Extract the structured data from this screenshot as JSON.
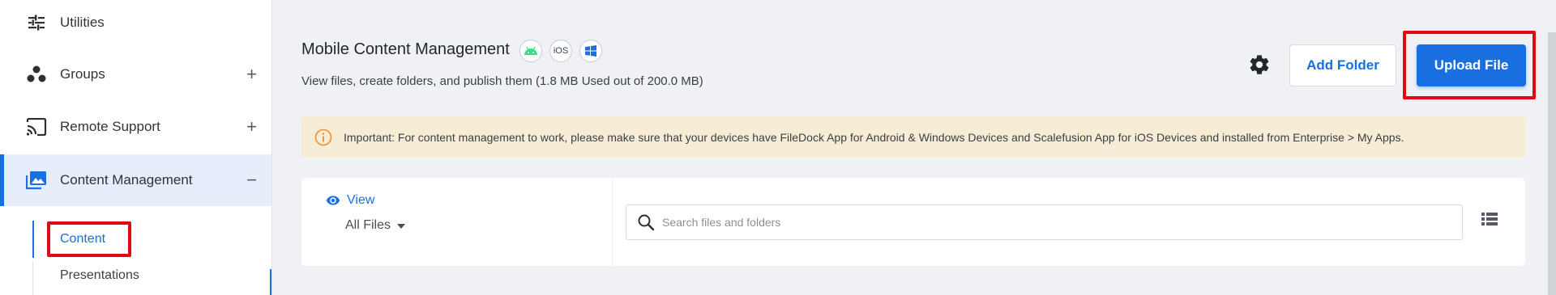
{
  "sidebar": {
    "items": [
      {
        "label": "Utilities",
        "icon": "sliders-icon",
        "toggle": ""
      },
      {
        "label": "Groups",
        "icon": "groups-icon",
        "toggle": "+"
      },
      {
        "label": "Remote Support",
        "icon": "cast-icon",
        "toggle": "+"
      },
      {
        "label": "Content Management",
        "icon": "photo-library-icon",
        "toggle": "−"
      }
    ],
    "sub_items": [
      {
        "label": "Content",
        "active": true
      },
      {
        "label": "Presentations",
        "active": false
      }
    ]
  },
  "header": {
    "title": "Mobile Content Management",
    "subtitle": "View files, create folders, and publish them (1.8 MB Used out of 200.0 MB)",
    "os_badges": [
      "android-icon",
      "iOS",
      "windows-icon"
    ],
    "add_folder_label": "Add Folder",
    "upload_file_label": "Upload File"
  },
  "notice": {
    "text": "Important: For content management to work, please make sure that your devices have FileDock App for Android & Windows Devices and Scalefusion App for iOS Devices and installed from Enterprise > My Apps."
  },
  "files_panel": {
    "view_label": "View",
    "filter_value": "All Files",
    "search_placeholder": "Search files and folders"
  },
  "colors": {
    "accent": "#1a6fe0",
    "highlight": "#e30613",
    "notice_bg": "#f7ecd6",
    "android": "#3ddc84",
    "windows": "#1a6fe0"
  }
}
